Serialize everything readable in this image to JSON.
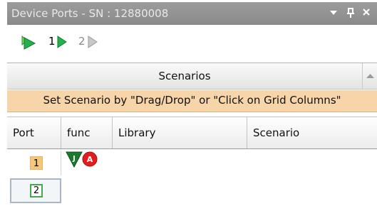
{
  "window": {
    "title": "Device Ports - SN : 12880008",
    "menu_icon": "dropdown-arrow-icon",
    "pin_icon": "pin-icon",
    "close_icon": "close-icon"
  },
  "toolbar": {
    "items": [
      {
        "icon": "play-all-green-icon"
      },
      {
        "label": "1",
        "icon": "play-green-icon"
      },
      {
        "label": "2",
        "icon": "play-gray-icon"
      }
    ]
  },
  "scenarios": {
    "title": "Scenarios",
    "hint": "Set Scenario by \"Drag/Drop\" or \"Click on Grid Columns\""
  },
  "grid": {
    "columns": [
      "Port",
      "func",
      "Library",
      "Scenario"
    ],
    "rows": [
      {
        "port": "1",
        "func_icons": [
          {
            "letter": "J",
            "shape": "green-triangle"
          },
          {
            "letter": "A",
            "shape": "red-circle"
          }
        ],
        "library": "",
        "scenario": ""
      },
      {
        "port": "2",
        "func_icons": [],
        "library": "",
        "scenario": ""
      }
    ]
  },
  "colors": {
    "title_bar": "#959595",
    "hint_bg": "#f8d4a9",
    "port1_badge": "#f4c77c",
    "port2_badge_border": "#49a649",
    "green_play": "#22b14c",
    "func_j": "#1c7a2e",
    "func_a": "#e11d1d"
  }
}
